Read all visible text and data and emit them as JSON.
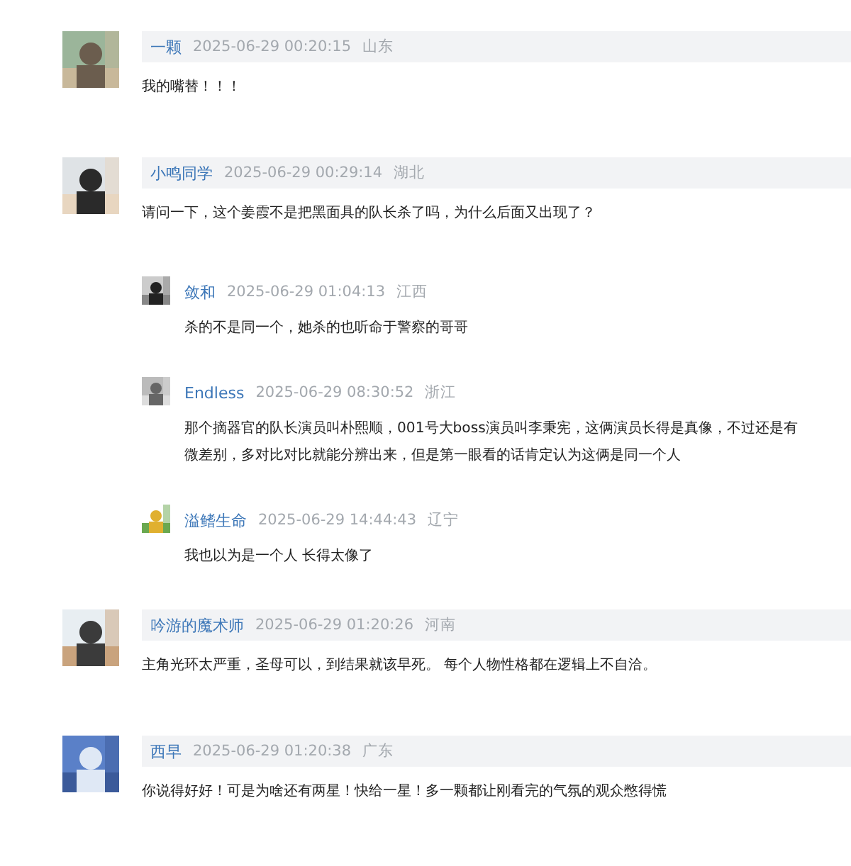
{
  "comments": [
    {
      "author": "一颗",
      "time": "2025-06-29 00:20:15",
      "region": "山东",
      "avatar": {
        "kind": "picture"
      },
      "lines": [
        "我的嘴替！！！"
      ]
    },
    {
      "author": "小鸣同学",
      "time": "2025-06-29 00:29:14",
      "region": "湖北",
      "avatar": {
        "kind": "picture"
      },
      "lines": [
        "请问一下，这个姜霞不是把黑面具的队长杀了吗，为什么后面又出现了？"
      ],
      "children": [
        {
          "author": "敛和",
          "time": "2025-06-29 01:04:13",
          "region": "江西",
          "avatar": {
            "kind": "picture"
          },
          "lines": [
            "杀的不是同一个，她杀的也听命于警察的哥哥"
          ]
        },
        {
          "author": "Endless",
          "time": "2025-06-29 08:30:52",
          "region": "浙江",
          "avatar": {
            "kind": "picture"
          },
          "lines": [
            "那个摘器官的队长演员叫朴熙顺，001号大boss演员叫李秉宪，这俩演员长得是真像，不过还是有",
            "微差别，多对比对比就能分辨出来，但是第一眼看的话肯定认为这俩是同一个人"
          ]
        },
        {
          "author": "溢鳍生命",
          "time": "2025-06-29 14:44:43",
          "region": "辽宁",
          "avatar": {
            "kind": "picture"
          },
          "lines": [
            "我也以为是一个人 长得太像了"
          ]
        }
      ]
    },
    {
      "author": "吟游的魔术师",
      "time": "2025-06-29 01:20:26",
      "region": "河南",
      "avatar": {
        "kind": "picture"
      },
      "lines": [
        "主角光环太严重，圣母可以，到结果就该早死。 每个人物性格都在逻辑上不自洽。"
      ]
    },
    {
      "author": "西早",
      "time": "2025-06-29 01:20:38",
      "region": "广东",
      "avatar": {
        "kind": "picture"
      },
      "lines": [
        "你说得好好！可是为啥还有两星！快给一星！多一颗都让刚看完的气氛的观众憋得慌"
      ]
    }
  ]
}
